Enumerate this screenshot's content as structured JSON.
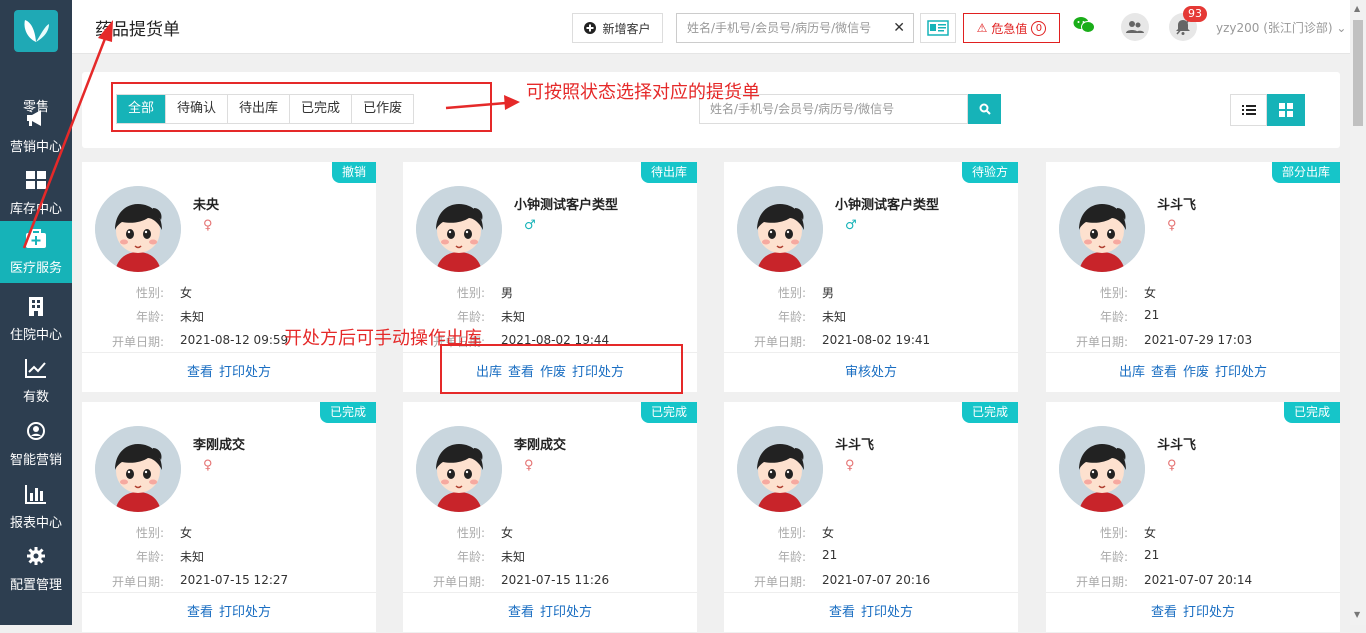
{
  "sidebar": {
    "items": [
      {
        "label": "零售",
        "icon": "retail-icon"
      },
      {
        "label": "营销中心",
        "icon": "megaphone-icon"
      },
      {
        "label": "库存中心",
        "icon": "grid-icon"
      },
      {
        "label": "医疗服务",
        "icon": "medical-kit-icon"
      },
      {
        "label": "住院中心",
        "icon": "building-icon"
      },
      {
        "label": "有数",
        "icon": "line-chart-icon"
      },
      {
        "label": "智能营销",
        "icon": "smart-marketing-icon"
      },
      {
        "label": "报表中心",
        "icon": "bar-chart-icon"
      },
      {
        "label": "配置管理",
        "icon": "gear-icon"
      }
    ]
  },
  "header": {
    "title": "药品提货单",
    "new_customer": "新增客户",
    "search_placeholder": "姓名/手机号/会员号/病历号/微信号",
    "alert_label": "危急值",
    "alert_count": "0",
    "notification_count": "93",
    "user": "yzy200 (张江门诊部)"
  },
  "filters": {
    "tabs": [
      "全部",
      "待确认",
      "待出库",
      "已完成",
      "已作废"
    ],
    "active_tab": "全部",
    "search_placeholder": "姓名/手机号/会员号/病历号/微信号"
  },
  "labels": {
    "gender": "性别:",
    "age": "年龄:",
    "date": "开单日期:"
  },
  "cards": [
    {
      "status": "撤销",
      "name": "未央",
      "gender": "女",
      "age": "未知",
      "date": "2021-08-12 09:59",
      "actions": [
        "查看",
        "打印处方"
      ]
    },
    {
      "status": "待出库",
      "name": "小钟测试客户类型",
      "gender": "男",
      "age": "未知",
      "date": "2021-08-02 19:44",
      "actions": [
        "出库",
        "查看",
        "作废",
        "打印处方"
      ]
    },
    {
      "status": "待验方",
      "name": "小钟测试客户类型",
      "gender": "男",
      "age": "未知",
      "date": "2021-08-02 19:41",
      "actions": [
        "审核处方"
      ]
    },
    {
      "status": "部分出库",
      "name": "斗斗飞",
      "gender": "女",
      "age": "21",
      "date": "2021-07-29 17:03",
      "actions": [
        "出库",
        "查看",
        "作废",
        "打印处方"
      ]
    },
    {
      "status": "已完成",
      "name": "李刚成交",
      "gender": "女",
      "age": "未知",
      "date": "2021-07-15 12:27",
      "actions": [
        "查看",
        "打印处方"
      ]
    },
    {
      "status": "已完成",
      "name": "李刚成交",
      "gender": "女",
      "age": "未知",
      "date": "2021-07-15 11:26",
      "actions": [
        "查看",
        "打印处方"
      ]
    },
    {
      "status": "已完成",
      "name": "斗斗飞",
      "gender": "女",
      "age": "21",
      "date": "2021-07-07 20:16",
      "actions": [
        "查看",
        "打印处方"
      ]
    },
    {
      "status": "已完成",
      "name": "斗斗飞",
      "gender": "女",
      "age": "21",
      "date": "2021-07-07 20:14",
      "actions": [
        "查看",
        "打印处方"
      ]
    }
  ],
  "annotations": {
    "filter_note": "可按照状态选择对应的提货单",
    "dispense_note": "开处方后可手动操作出库"
  },
  "colors": {
    "accent": "#16b3b8",
    "sidebar": "#2d3e50",
    "annotation": "#e52929",
    "link": "#1a6ec2"
  }
}
